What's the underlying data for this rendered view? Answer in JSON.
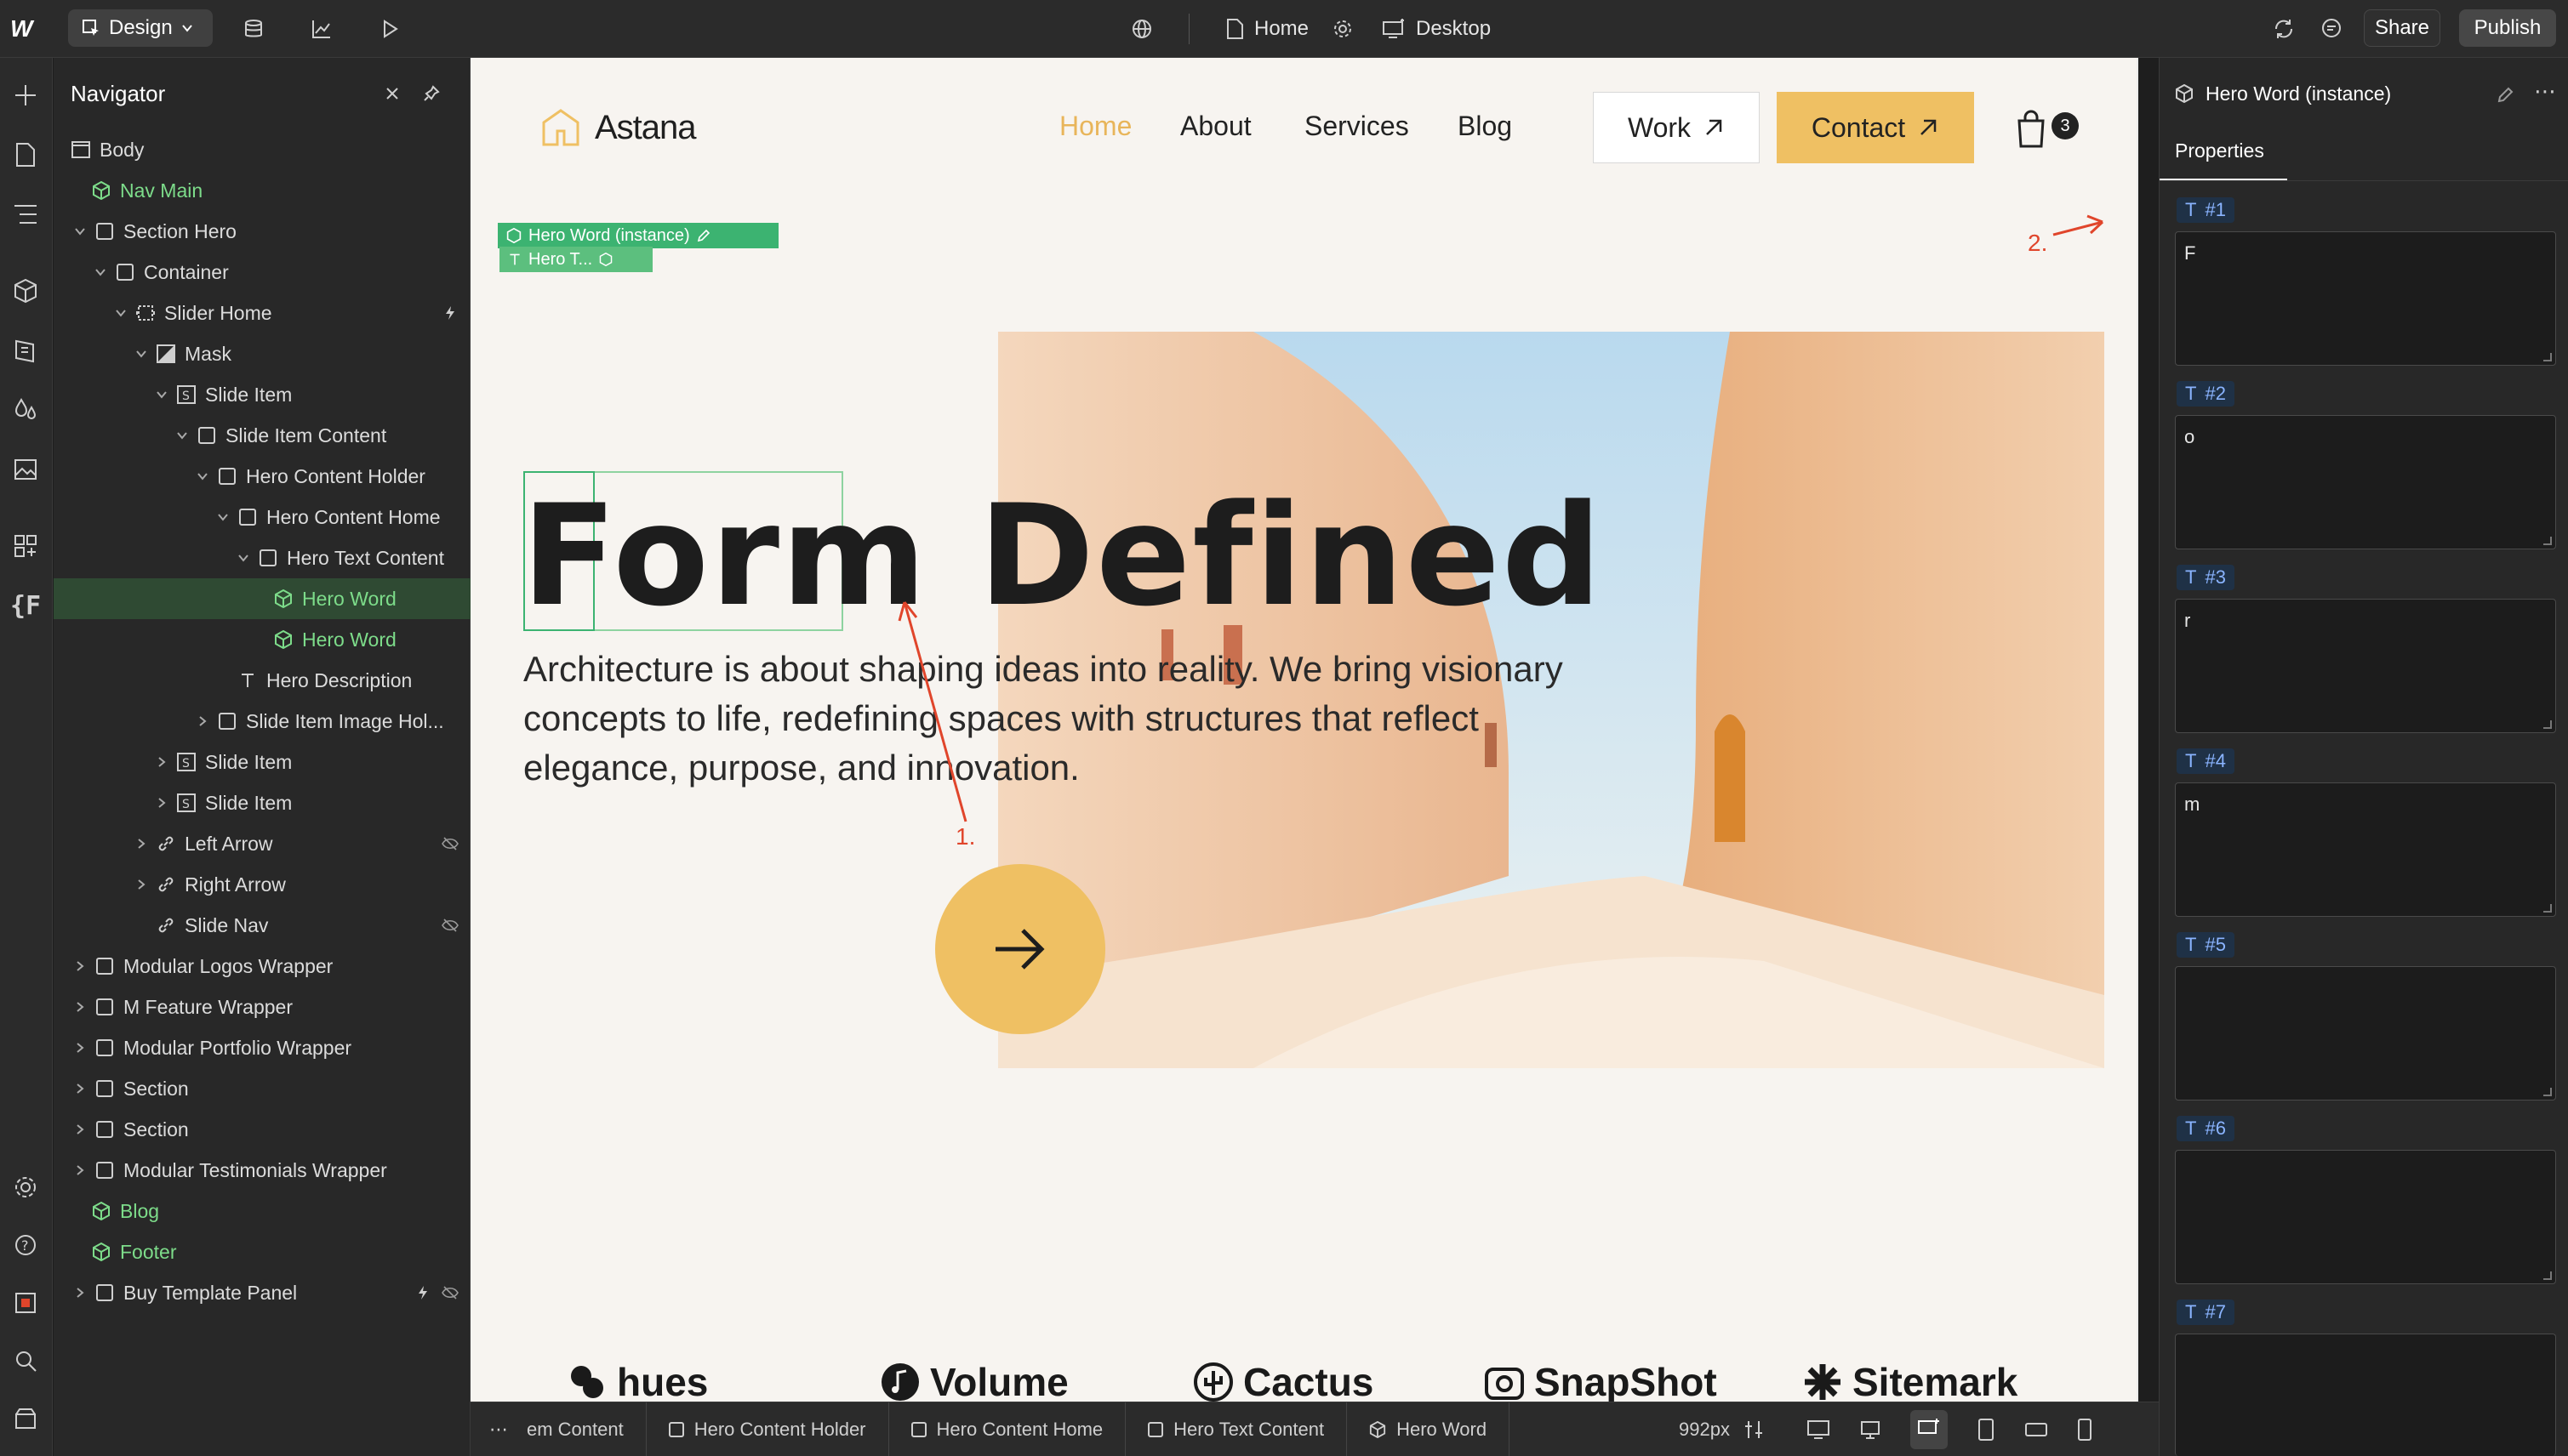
{
  "topbar": {
    "mode_label": "Design",
    "page_label": "Home",
    "device_label": "Desktop",
    "share_label": "Share",
    "publish_label": "Publish"
  },
  "navigator": {
    "title": "Navigator",
    "items": [
      {
        "label": "Body"
      },
      {
        "label": "Nav Main"
      },
      {
        "label": "Section Hero"
      },
      {
        "label": "Container"
      },
      {
        "label": "Slider Home"
      },
      {
        "label": "Mask"
      },
      {
        "label": "Slide Item"
      },
      {
        "label": "Slide Item Content"
      },
      {
        "label": "Hero Content Holder"
      },
      {
        "label": "Hero Content Home"
      },
      {
        "label": "Hero Text Content"
      },
      {
        "label": "Hero Word"
      },
      {
        "label": "Hero Word"
      },
      {
        "label": "Hero Description"
      },
      {
        "label": "Slide Item Image Hol..."
      },
      {
        "label": "Slide Item"
      },
      {
        "label": "Slide Item"
      },
      {
        "label": "Left Arrow"
      },
      {
        "label": "Right Arrow"
      },
      {
        "label": "Slide Nav"
      },
      {
        "label": "Modular Logos Wrapper"
      },
      {
        "label": "M Feature Wrapper"
      },
      {
        "label": "Modular Portfolio Wrapper"
      },
      {
        "label": "Section"
      },
      {
        "label": "Section"
      },
      {
        "label": "Modular Testimonials Wrapper"
      },
      {
        "label": "Blog"
      },
      {
        "label": "Footer"
      },
      {
        "label": "Buy Template Panel"
      }
    ]
  },
  "canvas": {
    "logo_text": "Astana",
    "nav": [
      "Home",
      "About",
      "Services",
      "Blog"
    ],
    "work_label": "Work",
    "contact_label": "Contact",
    "cart_count": "3",
    "hero_title": "Form Defined",
    "hero_desc": "Architecture is about shaping ideas into reality. We bring visionary concepts to life, redefining spaces with structures that reflect elegance, purpose, and innovation.",
    "selection_label_1": "Hero Word (instance)",
    "selection_label_2": "Hero T...",
    "logos": [
      "hues",
      "Volume",
      "Cactus",
      "SnapShot",
      "Sitemark"
    ],
    "annotation_1": "1.",
    "annotation_2": "2."
  },
  "breadcrumb": {
    "items": [
      "em Content",
      "Hero Content Holder",
      "Hero Content Home",
      "Hero Text Content",
      "Hero Word"
    ],
    "width_label": "992px"
  },
  "properties": {
    "title": "Hero Word (instance)",
    "tab": "Properties",
    "fields": [
      {
        "label": "#1",
        "value": "F"
      },
      {
        "label": "#2",
        "value": "o"
      },
      {
        "label": "#3",
        "value": "r"
      },
      {
        "label": "#4",
        "value": "m"
      },
      {
        "label": "#5",
        "value": ""
      },
      {
        "label": "#6",
        "value": ""
      },
      {
        "label": "#7",
        "value": ""
      }
    ]
  },
  "colors": {
    "accent_yellow": "#efc063",
    "nav_active": "#e8b55a",
    "selection_green": "#3cb371",
    "annotation_red": "#e0452b"
  }
}
